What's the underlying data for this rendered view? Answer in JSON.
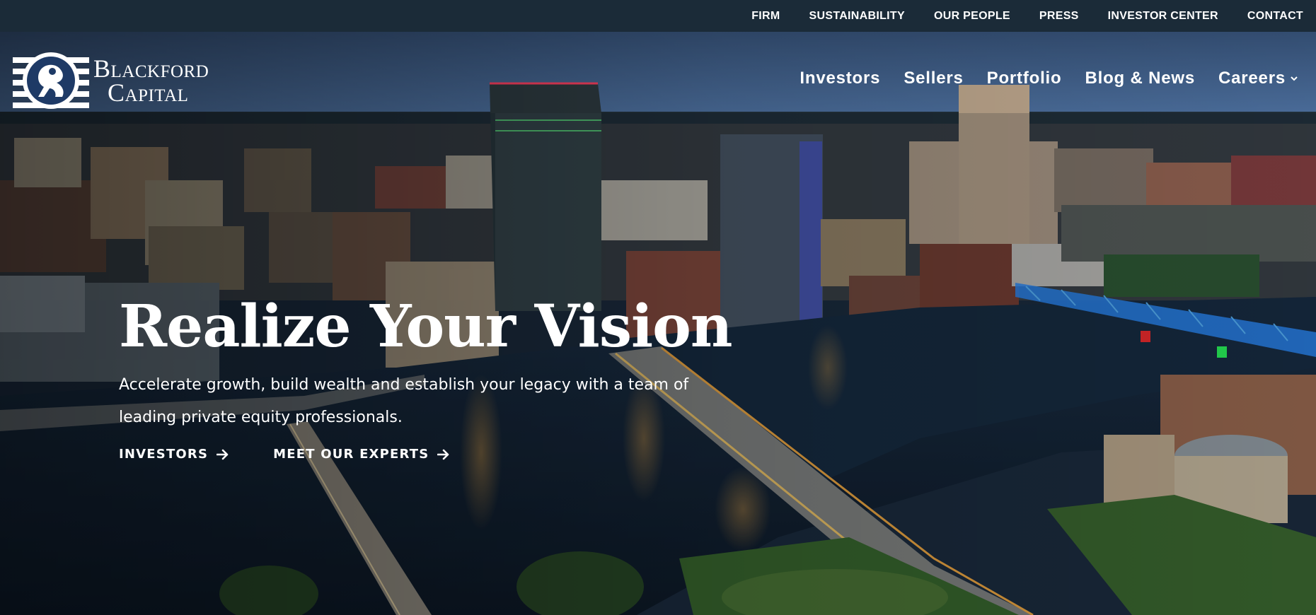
{
  "utility_nav": [
    {
      "label": "FIRM"
    },
    {
      "label": "SUSTAINABILITY"
    },
    {
      "label": "OUR PEOPLE"
    },
    {
      "label": "PRESS"
    },
    {
      "label": "INVESTOR CENTER"
    },
    {
      "label": "CONTACT"
    }
  ],
  "brand": {
    "line1": "Blackford",
    "line2": "Capital",
    "logo_icon": "pegasus-emblem-icon"
  },
  "main_nav": [
    {
      "label": "Investors"
    },
    {
      "label": "Sellers"
    },
    {
      "label": "Portfolio"
    },
    {
      "label": "Blog & News"
    },
    {
      "label": "Careers",
      "icon": "chevron-down-icon"
    }
  ],
  "hero": {
    "title": "Realize Your Vision",
    "subtitle": "Accelerate growth, build wealth and establish your legacy with a team of leading private equity professionals.",
    "ctas": [
      {
        "label": "INVESTORS",
        "icon": "arrow-right-icon"
      },
      {
        "label": "MEET OUR EXPERTS",
        "icon": "arrow-right-icon"
      }
    ]
  },
  "colors": {
    "utility_bar": "#1b2b38",
    "text": "#ffffff",
    "sky": "#3d5f8e",
    "water": "#0f1e2e",
    "bridge_light": "#2a8cff"
  }
}
